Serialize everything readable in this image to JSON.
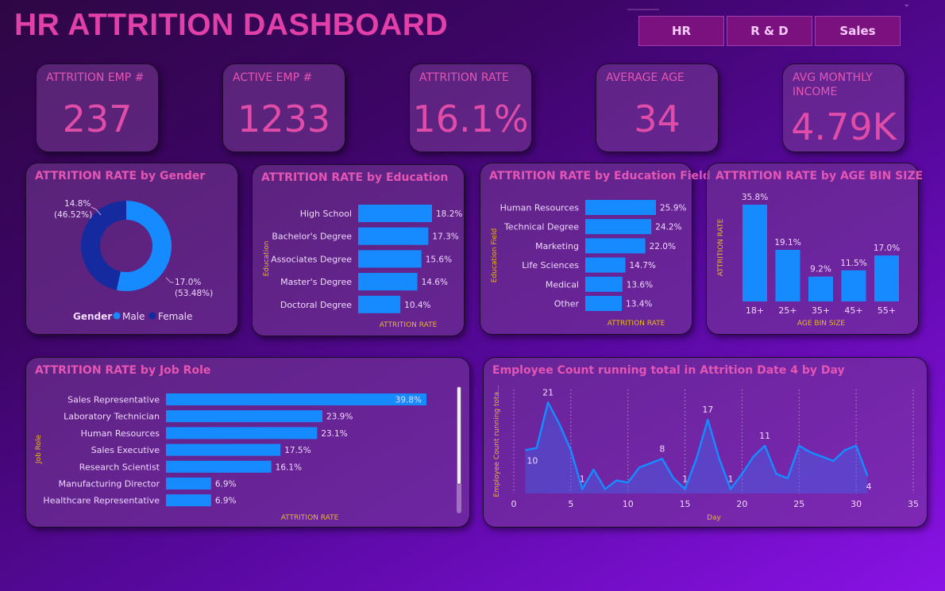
{
  "title": "HR ATTRITION DASHBOARD",
  "slicer": {
    "buttons": [
      "HR",
      "R & D",
      "Sales"
    ]
  },
  "kpis": [
    {
      "label": "ATTRITION EMP #",
      "value": "237"
    },
    {
      "label": "ACTIVE EMP #",
      "value": "1233"
    },
    {
      "label": "ATTRITION RATE",
      "value": "16.1%"
    },
    {
      "label": "AVERAGE AGE",
      "value": "34"
    },
    {
      "label": "AVG MONTHLY INCOME",
      "value": "4.79K"
    }
  ],
  "colors": {
    "bar": "#168bff",
    "female": "#142a9e",
    "male": "#168bff",
    "title": "#e556b4",
    "axis_title": "#e8b820"
  },
  "chart_data": [
    {
      "id": "gender",
      "type": "pie",
      "title": "ATTRITION RATE by Gender",
      "legend_title": "Gender",
      "legend": [
        "Male",
        "Female"
      ],
      "legend_position": "bottom",
      "slices": [
        {
          "name": "Male",
          "value": 17.0,
          "label": "17.0%",
          "pct_label": "(53.48%)"
        },
        {
          "name": "Female",
          "value": 14.8,
          "label": "14.8%",
          "pct_label": "(46.52%)"
        }
      ]
    },
    {
      "id": "education",
      "type": "bar",
      "orientation": "horizontal",
      "title": "ATTRITION RATE by Education",
      "xlabel": "ATTRITION RATE",
      "ylabel": "Education",
      "categories": [
        "High School",
        "Bachelor's Degree",
        "Associates Degree",
        "Master's Degree",
        "Doctoral Degree"
      ],
      "values": [
        18.2,
        17.3,
        15.6,
        14.6,
        10.4
      ],
      "labels": [
        "18.2%",
        "17.3%",
        "15.6%",
        "14.6%",
        "10.4%"
      ]
    },
    {
      "id": "edufield",
      "type": "bar",
      "orientation": "horizontal",
      "title": "ATTRITION RATE by Education Field",
      "xlabel": "ATTRITION RATE",
      "ylabel": "Education Field",
      "categories": [
        "Human Resources",
        "Technical Degree",
        "Marketing",
        "Life Sciences",
        "Medical",
        "Other"
      ],
      "values": [
        25.9,
        24.2,
        22.0,
        14.7,
        13.6,
        13.4
      ],
      "labels": [
        "25.9%",
        "24.2%",
        "22.0%",
        "14.7%",
        "13.6%",
        "13.4%"
      ]
    },
    {
      "id": "agebin",
      "type": "bar",
      "orientation": "vertical",
      "title": "ATTRITION RATE by AGE BIN SIZE",
      "xlabel": "AGE BIN SIZE",
      "ylabel": "ATTRITION RATE",
      "categories": [
        "18+",
        "25+",
        "35+",
        "45+",
        "55+"
      ],
      "values": [
        35.8,
        19.1,
        9.2,
        11.5,
        17.0
      ],
      "labels": [
        "35.8%",
        "19.1%",
        "9.2%",
        "11.5%",
        "17.0%"
      ]
    },
    {
      "id": "jobrole",
      "type": "bar",
      "orientation": "horizontal",
      "title": "ATTRITION RATE by Job Role",
      "xlabel": "ATTRITION RATE",
      "ylabel": "Job Role",
      "categories": [
        "Sales Representative",
        "Laboratory Technician",
        "Human Resources",
        "Sales Executive",
        "Research Scientist",
        "Manufacturing Director",
        "Healthcare Representative"
      ],
      "values": [
        39.8,
        23.9,
        23.1,
        17.5,
        16.1,
        6.9,
        6.9
      ],
      "labels": [
        "39.8%",
        "23.9%",
        "23.1%",
        "17.5%",
        "16.1%",
        "6.9%",
        "6.9%"
      ]
    },
    {
      "id": "runningtotal",
      "type": "area",
      "title": "Employee Count running total in Attrition Date 4 by Day",
      "xlabel": "Day",
      "ylabel": "Employee Count running tota...",
      "xlim": [
        0,
        35
      ],
      "ylim": [
        0,
        24
      ],
      "xticks": [
        "0",
        "5",
        "10",
        "15",
        "20",
        "25",
        "30",
        "35"
      ],
      "x": [
        1,
        2,
        3,
        4,
        5,
        6,
        7,
        8,
        9,
        10,
        11,
        12,
        13,
        14,
        15,
        16,
        17,
        18,
        19,
        20,
        21,
        22,
        23,
        24,
        25,
        26,
        27,
        28,
        29,
        30,
        31
      ],
      "y": [
        10,
        10.5,
        21,
        16,
        10,
        1,
        5.5,
        1,
        3,
        2.5,
        6,
        7,
        8,
        3.5,
        1,
        8,
        17,
        8,
        1,
        4.5,
        8.5,
        11,
        4.5,
        3.5,
        11,
        9.5,
        8.5,
        7.5,
        10,
        11,
        4
      ],
      "annotations": [
        {
          "x": 1,
          "y": 10,
          "label": "10"
        },
        {
          "x": 3,
          "y": 21,
          "label": "21"
        },
        {
          "x": 6,
          "y": 1,
          "label": "1"
        },
        {
          "x": 13,
          "y": 8,
          "label": "8"
        },
        {
          "x": 15,
          "y": 1,
          "label": "1"
        },
        {
          "x": 17,
          "y": 17,
          "label": "17"
        },
        {
          "x": 19,
          "y": 1,
          "label": "1"
        },
        {
          "x": 22,
          "y": 11,
          "label": "11"
        },
        {
          "x": 31,
          "y": 4,
          "label": "4"
        }
      ]
    }
  ]
}
